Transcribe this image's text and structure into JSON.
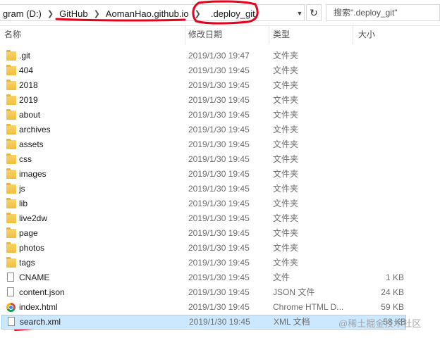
{
  "address": {
    "crumbs": [
      "gram (D:)",
      "GitHub",
      "AomanHao.github.io",
      ".deploy_git"
    ],
    "search_placeholder": "搜索\".deploy_git\""
  },
  "columns": {
    "name": "名称",
    "date": "修改日期",
    "type": "类型",
    "size": "大小"
  },
  "files": [
    {
      "name": ".git",
      "date": "2019/1/30 19:47",
      "type": "文件夹",
      "size": "",
      "icon": "folder-icon"
    },
    {
      "name": "404",
      "date": "2019/1/30 19:45",
      "type": "文件夹",
      "size": "",
      "icon": "folder-icon"
    },
    {
      "name": "2018",
      "date": "2019/1/30 19:45",
      "type": "文件夹",
      "size": "",
      "icon": "folder-icon"
    },
    {
      "name": "2019",
      "date": "2019/1/30 19:45",
      "type": "文件夹",
      "size": "",
      "icon": "folder-icon"
    },
    {
      "name": "about",
      "date": "2019/1/30 19:45",
      "type": "文件夹",
      "size": "",
      "icon": "folder-icon"
    },
    {
      "name": "archives",
      "date": "2019/1/30 19:45",
      "type": "文件夹",
      "size": "",
      "icon": "folder-icon"
    },
    {
      "name": "assets",
      "date": "2019/1/30 19:45",
      "type": "文件夹",
      "size": "",
      "icon": "folder-icon"
    },
    {
      "name": "css",
      "date": "2019/1/30 19:45",
      "type": "文件夹",
      "size": "",
      "icon": "folder-icon"
    },
    {
      "name": "images",
      "date": "2019/1/30 19:45",
      "type": "文件夹",
      "size": "",
      "icon": "folder-icon"
    },
    {
      "name": "js",
      "date": "2019/1/30 19:45",
      "type": "文件夹",
      "size": "",
      "icon": "folder-icon"
    },
    {
      "name": "lib",
      "date": "2019/1/30 19:45",
      "type": "文件夹",
      "size": "",
      "icon": "folder-icon"
    },
    {
      "name": "live2dw",
      "date": "2019/1/30 19:45",
      "type": "文件夹",
      "size": "",
      "icon": "folder-icon"
    },
    {
      "name": "page",
      "date": "2019/1/30 19:45",
      "type": "文件夹",
      "size": "",
      "icon": "folder-icon"
    },
    {
      "name": "photos",
      "date": "2019/1/30 19:45",
      "type": "文件夹",
      "size": "",
      "icon": "folder-icon"
    },
    {
      "name": "tags",
      "date": "2019/1/30 19:45",
      "type": "文件夹",
      "size": "",
      "icon": "folder-icon"
    },
    {
      "name": "CNAME",
      "date": "2019/1/30 19:45",
      "type": "文件",
      "size": "1 KB",
      "icon": "file-icon"
    },
    {
      "name": "content.json",
      "date": "2019/1/30 19:45",
      "type": "JSON 文件",
      "size": "24 KB",
      "icon": "file-icon"
    },
    {
      "name": "index.html",
      "date": "2019/1/30 19:45",
      "type": "Chrome HTML D...",
      "size": "59 KB",
      "icon": "chrome-icon"
    },
    {
      "name": "search.xml",
      "date": "2019/1/30 19:45",
      "type": "XML 文档",
      "size": "58 KB",
      "icon": "file-icon",
      "selected": true
    }
  ],
  "watermark": "@稀土掘金技术社区",
  "colors": {
    "annotation": "#e8001c",
    "selection_bg": "#cce8ff",
    "selection_border": "#99d1ff",
    "folder": "#f2bf3f"
  }
}
